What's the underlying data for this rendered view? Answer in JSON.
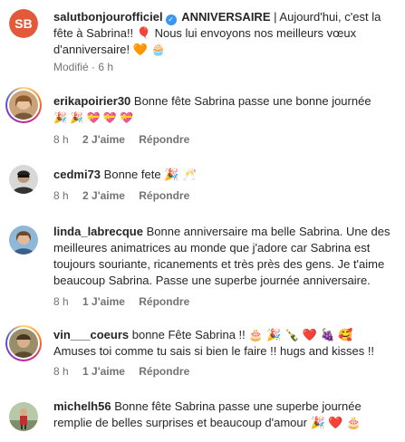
{
  "post": {
    "username": "salutbonjourofficiel",
    "verified": true,
    "title": "ANNIVERSAIRE",
    "separator": "|",
    "caption": "Aujourd'hui, c'est la fête à Sabrina!! 🎈 Nous lui envoyons nos meilleurs vœux d'anniversaire! 🧡 🧁",
    "edited": "Modifié · 6 h"
  },
  "comments": [
    {
      "username": "erikapoirier30",
      "text": "Bonne fête Sabrina passe une bonne journée",
      "emojis": "🎉 🎉 💝 💝 💝",
      "time": "8 h",
      "likes": "2 J'aime",
      "reply": "Répondre"
    },
    {
      "username": "cedmi73",
      "text": "Bonne fete 🎉 🥂",
      "time": "8 h",
      "likes": "2 J'aime",
      "reply": "Répondre"
    },
    {
      "username": "linda_labrecque",
      "text": "Bonne anniversaire ma belle Sabrina. Une des meilleures animatrices au monde que j'adore car Sabrina est toujours souriante, ricanements et très près des gens. Je t'aime beaucoup Sabrina. Passe une superbe journée anniversaire.",
      "time": "8 h",
      "likes": "1 J'aime",
      "reply": "Répondre"
    },
    {
      "username": "vin___coeurs",
      "text": "bonne Fête Sabrina !! 🎂 🎉 🍾 ❤️ 🍇 🥰 Amuses toi comme tu sais si bien le faire !! hugs and kisses !!",
      "time": "8 h",
      "likes": "1 J'aime",
      "reply": "Répondre"
    },
    {
      "username": "michelh56",
      "text": "Bonne fête Sabrina passe une superbe journée remplie de belles surprises et beaucoup d'amour 🎉 ❤️ 🎂",
      "time": "",
      "likes": "",
      "reply": ""
    }
  ],
  "colors": {
    "text": "#262626",
    "secondary": "#737373",
    "verified": "#3897f0",
    "avatar_sb": "#e25a3a"
  }
}
